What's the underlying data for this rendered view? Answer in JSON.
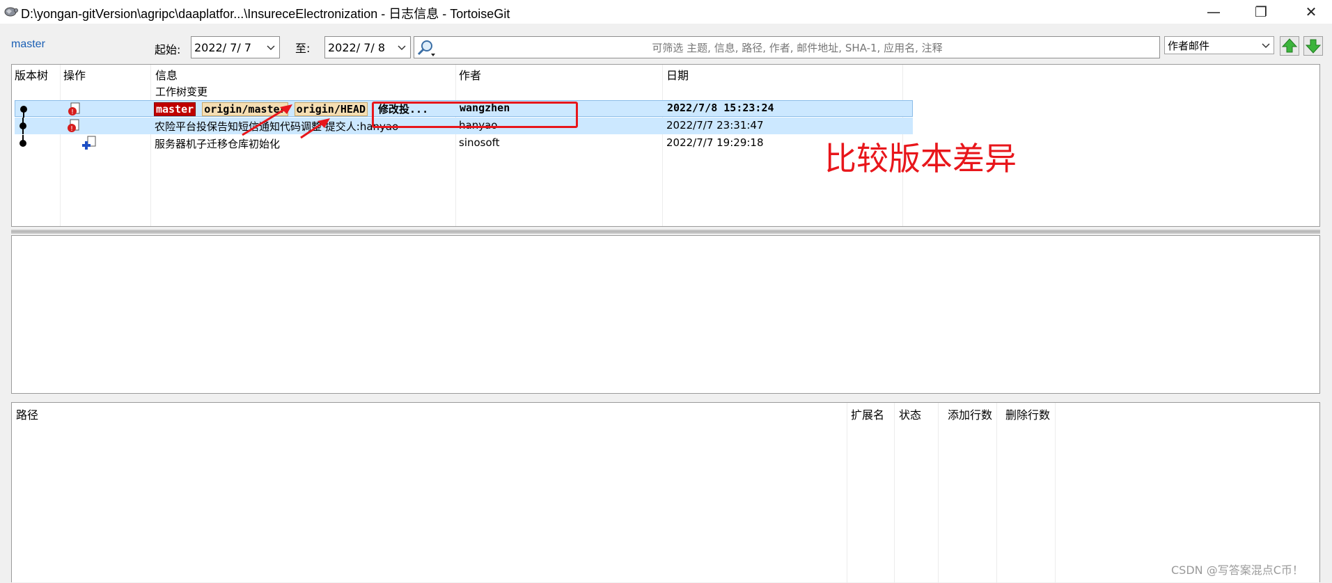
{
  "window": {
    "title": "D:\\yongan-gitVersion\\agripc\\daaplatfor...\\InsureceElectronization - 日志信息 - TortoiseGit",
    "minimize_glyph": "—",
    "maximize_glyph": "❐",
    "close_glyph": "✕"
  },
  "toolbar": {
    "branch": "master",
    "from_label": "起始:",
    "from_date": "2022/ 7/ 7",
    "to_label": "至:",
    "to_date": "2022/ 7/ 8",
    "search_placeholder": "可筛选 主题, 信息, 路径, 作者, 邮件地址, SHA-1, 应用名, 注释",
    "filter_value": "作者邮件"
  },
  "log": {
    "columns": [
      "版本树",
      "操作",
      "信息",
      "作者",
      "日期"
    ],
    "working_tree": "工作树变更",
    "rows": [
      {
        "refs": [
          "master",
          "origin/master",
          "origin/HEAD"
        ],
        "message": "修改投...",
        "author": "wangzhen",
        "date": "2022/7/8 15:23:24"
      },
      {
        "message": "农险平台投保告知短信通知代码调整 提交人:hanyao",
        "author": "hanyao",
        "date": "2022/7/7 23:31:47"
      },
      {
        "message": "服务器机子迁移仓库初始化",
        "author": "sinosoft",
        "date": "2022/7/7 19:29:18"
      }
    ]
  },
  "files": {
    "columns": [
      "路径",
      "扩展名",
      "状态",
      "添加行数",
      "删除行数"
    ]
  },
  "annotation": {
    "text": "比较版本差异"
  },
  "watermark": "CSDN @写答案混点C币！",
  "colors": {
    "annotation_red": "#e8161b",
    "selection_blue": "#cce8ff",
    "branch_tag_red": "#c00000",
    "remote_tag_tan": "#f5deb3"
  }
}
